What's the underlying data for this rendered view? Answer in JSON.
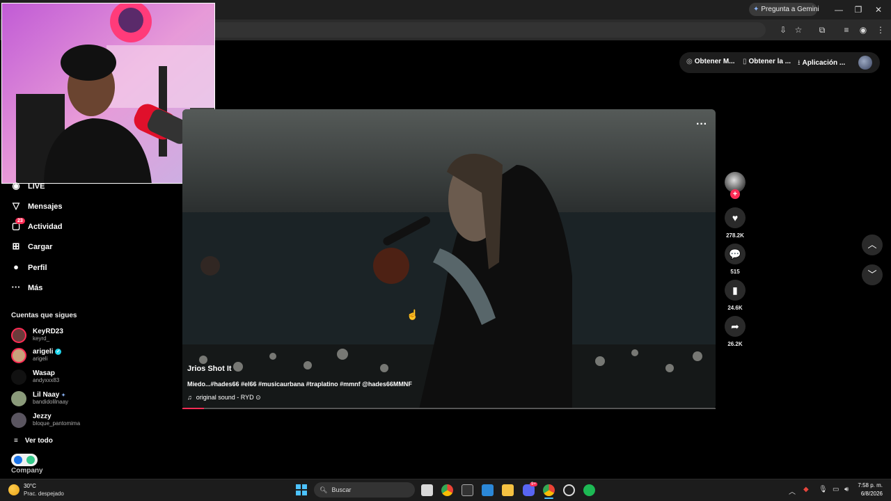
{
  "browser": {
    "gemini_button": "Pregunta a Gemini",
    "window_controls": [
      "minimize-icon",
      "restore-icon",
      "close-icon"
    ],
    "toolbar_icons": [
      "install-icon",
      "bookmark-star-icon",
      "extensions-icon",
      "media-icon",
      "profile-icon",
      "menu-icon"
    ]
  },
  "topbar": {
    "items": [
      {
        "icon": "coin-icon",
        "label": "Obtener M..."
      },
      {
        "icon": "phone-icon",
        "label": "Obtener la ..."
      },
      {
        "icon": "download-icon",
        "label": "Aplicación ..."
      }
    ]
  },
  "sidebar": {
    "items": [
      {
        "icon": "live-icon",
        "label": "LIVE"
      },
      {
        "icon": "messages-icon",
        "label": "Mensajes"
      },
      {
        "icon": "activity-icon",
        "label": "Actividad",
        "badge": "23"
      },
      {
        "icon": "upload-icon",
        "label": "Cargar"
      },
      {
        "icon": "profile-icon",
        "label": "Perfil"
      },
      {
        "icon": "more-icon",
        "label": "Más"
      }
    ],
    "following_title": "Cuentas que sigues",
    "accounts": [
      {
        "name": "KeyRD23",
        "handle": "keyrd_",
        "avatar_color": "#6b3b3b"
      },
      {
        "name": "arigeli",
        "handle": "arigeli",
        "verified": true,
        "avatar_color": "#c9a27c"
      },
      {
        "name": "Wasap",
        "handle": "andyxxx83",
        "avatar_color": "#111111"
      },
      {
        "name": "Lil Naay",
        "handle": "bandidolilnaay",
        "avatar_color": "#8a9a7a"
      },
      {
        "name": "Jezzy",
        "handle": "bloque_pantomima",
        "avatar_color": "#5a5560"
      }
    ],
    "see_all": "Ver todo",
    "company": "Company"
  },
  "video": {
    "title": "Jrios Shot It",
    "description": "Miedo...#hades66 #el66 #musicaurbana #traplatino #mmnf @hades66MMNF",
    "sound": "original sound - RYD",
    "progress": 0.04
  },
  "actions": {
    "likes": "278.2K",
    "comments": "515",
    "saves": "24.6K",
    "shares": "26.2K"
  },
  "taskbar": {
    "temperature": "30°C",
    "weather": "Prac. despejado",
    "search_placeholder": "Buscar",
    "time": "7:58 p. m.",
    "date": "6/8/2026",
    "apps": [
      "file-explorer-icon",
      "chrome-icon",
      "epic-games-icon",
      "photos-icon",
      "folder-icon",
      "discord-icon",
      "chrome-active-icon",
      "obs-icon",
      "spotify-icon"
    ],
    "discord_badge": "9+"
  },
  "colors": {
    "accent": "#fe2c55",
    "background": "#000000"
  }
}
